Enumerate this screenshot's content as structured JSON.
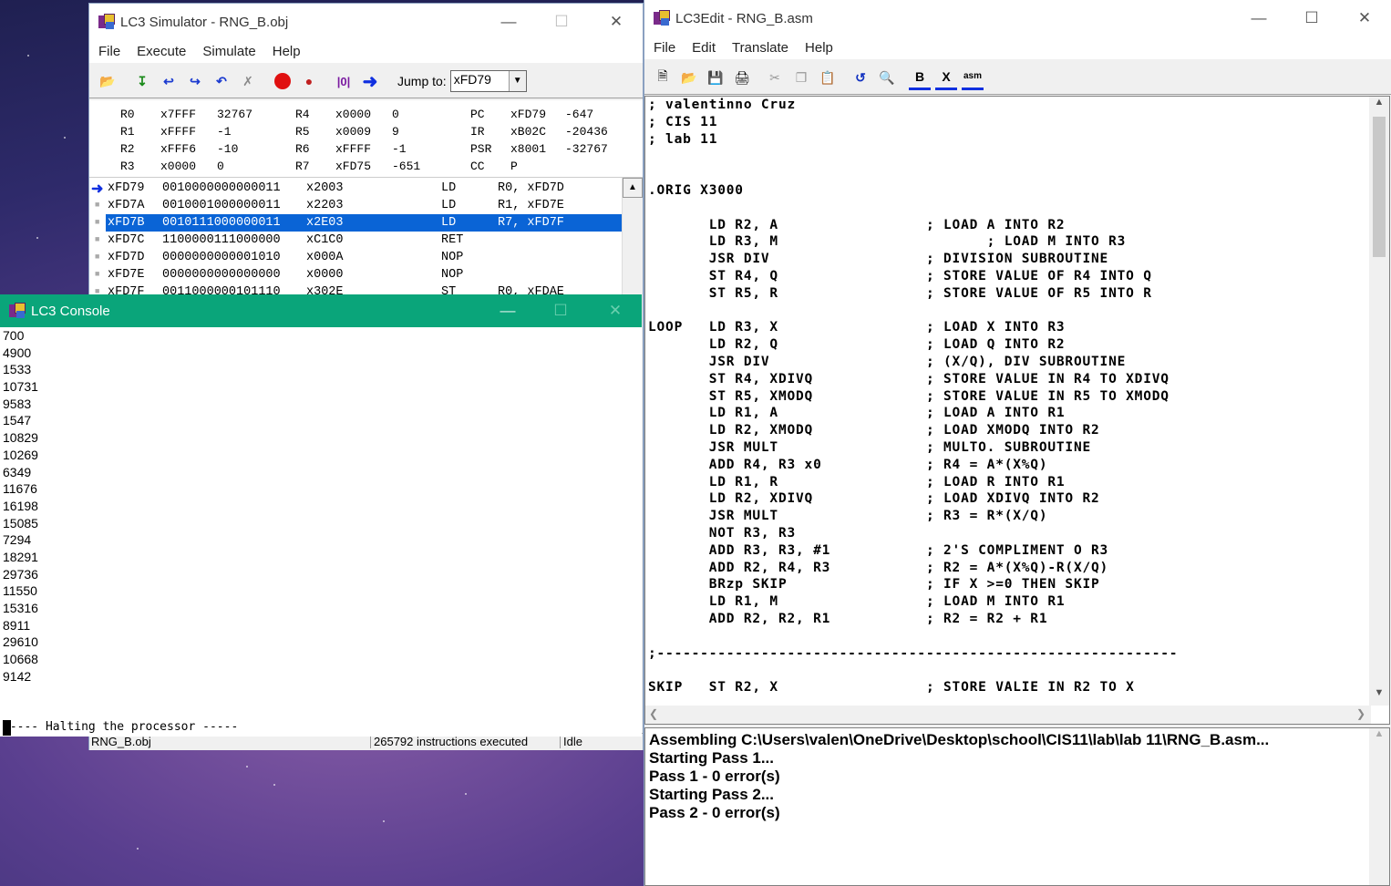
{
  "simulator": {
    "title": "LC3 Simulator - RNG_B.obj",
    "menu": [
      "File",
      "Execute",
      "Simulate",
      "Help"
    ],
    "jump_label": "Jump to:",
    "jump_value": "xFD79",
    "registers": [
      {
        "name": "R0",
        "hex": "x7FFF",
        "dec": "32767"
      },
      {
        "name": "R1",
        "hex": "xFFFF",
        "dec": "-1"
      },
      {
        "name": "R2",
        "hex": "xFFF6",
        "dec": "-10"
      },
      {
        "name": "R3",
        "hex": "x0000",
        "dec": "0"
      },
      {
        "name": "R4",
        "hex": "x0000",
        "dec": "0"
      },
      {
        "name": "R5",
        "hex": "x0009",
        "dec": "9"
      },
      {
        "name": "R6",
        "hex": "xFFFF",
        "dec": "-1"
      },
      {
        "name": "R7",
        "hex": "xFD75",
        "dec": "-651"
      },
      {
        "name": "PC",
        "hex": "xFD79",
        "dec": "-647"
      },
      {
        "name": "IR",
        "hex": "xB02C",
        "dec": "-20436"
      },
      {
        "name": "PSR",
        "hex": "x8001",
        "dec": "-32767"
      },
      {
        "name": "CC",
        "hex": "P",
        "dec": ""
      }
    ],
    "memory": [
      {
        "addr": "xFD79",
        "bin": "0010000000000011",
        "hex": "x2003",
        "op": "LD",
        "args": "R0, xFD7D"
      },
      {
        "addr": "xFD7A",
        "bin": "0010001000000011",
        "hex": "x2203",
        "op": "LD",
        "args": "R1, xFD7E"
      },
      {
        "addr": "xFD7B",
        "bin": "0010111000000011",
        "hex": "x2E03",
        "op": "LD",
        "args": "R7, xFD7F"
      },
      {
        "addr": "xFD7C",
        "bin": "1100000111000000",
        "hex": "xC1C0",
        "op": "RET",
        "args": ""
      },
      {
        "addr": "xFD7D",
        "bin": "0000000000001010",
        "hex": "x000A",
        "op": "NOP",
        "args": ""
      },
      {
        "addr": "xFD7E",
        "bin": "0000000000000000",
        "hex": "x0000",
        "op": "NOP",
        "args": ""
      },
      {
        "addr": "xFD7F",
        "bin": "0011000000101110",
        "hex": "x302E",
        "op": "ST",
        "args": "R0, xFDAE"
      }
    ],
    "status": {
      "file": "RNG_B.obj",
      "executed": "265792 instructions executed",
      "state": "Idle"
    }
  },
  "console": {
    "title": "LC3 Console",
    "lines": [
      "700",
      "4900",
      "1533",
      "10731",
      "9583",
      "1547",
      "10829",
      "10269",
      "6349",
      "11676",
      "16198",
      "15085",
      "7294",
      "18291",
      "29736",
      "11550",
      "15316",
      "8911",
      "29610",
      "10668",
      "9142",
      "",
      "",
      "----- Halting the processor -----"
    ]
  },
  "editor": {
    "title": "LC3Edit - RNG_B.asm",
    "menu": [
      "File",
      "Edit",
      "Translate",
      "Help"
    ],
    "code": [
      "; valentinno Cruz",
      "; CIS 11",
      "; lab 11",
      "",
      "",
      ".ORIG X3000",
      "",
      "       LD R2, A                 ; LOAD A INTO R2",
      "       LD R3, M                        ; LOAD M INTO R3",
      "       JSR DIV                  ; DIVISION SUBROUTINE",
      "       ST R4, Q                 ; STORE VALUE OF R4 INTO Q",
      "       ST R5, R                 ; STORE VALUE OF R5 INTO R",
      "",
      "LOOP   LD R3, X                 ; LOAD X INTO R3",
      "       LD R2, Q                 ; LOAD Q INTO R2",
      "       JSR DIV                  ; (X/Q), DIV SUBROUTINE",
      "       ST R4, XDIVQ             ; STORE VALUE IN R4 TO XDIVQ",
      "       ST R5, XMODQ             ; STORE VALUE IN R5 TO XMODQ",
      "       LD R1, A                 ; LOAD A INTO R1",
      "       LD R2, XMODQ             ; LOAD XMODQ INTO R2",
      "       JSR MULT                 ; MULTO. SUBROUTINE",
      "       ADD R4, R3 x0            ; R4 = A*(X%Q)",
      "       LD R1, R                 ; LOAD R INTO R1",
      "       LD R2, XDIVQ             ; LOAD XDIVQ INTO R2",
      "       JSR MULT                 ; R3 = R*(X/Q)",
      "       NOT R3, R3",
      "       ADD R3, R3, #1           ; 2'S COMPLIMENT O R3",
      "       ADD R2, R4, R3           ; R2 = A*(X%Q)-R(X/Q)",
      "       BRzp SKIP                ; IF X >=0 THEN SKIP",
      "       LD R1, M                 ; LOAD M INTO R1",
      "       ADD R2, R2, R1           ; R2 = R2 + R1",
      "",
      ";------------------------------------------------------------",
      "",
      "SKIP   ST R2, X                 ; STORE VALIE IN R2 TO X"
    ],
    "output": [
      "Assembling C:\\Users\\valen\\OneDrive\\Desktop\\school\\CIS11\\lab\\lab 11\\RNG_B.asm...",
      "Starting Pass 1...",
      "Pass 1 - 0 error(s)",
      "Starting Pass 2...",
      "Pass 2 - 0 error(s)"
    ]
  },
  "colors": {
    "console_title_bg": "#0aa57a",
    "selection": "#0a64d6",
    "breakpoint": "#e01010",
    "arrow": "#1030e0"
  }
}
